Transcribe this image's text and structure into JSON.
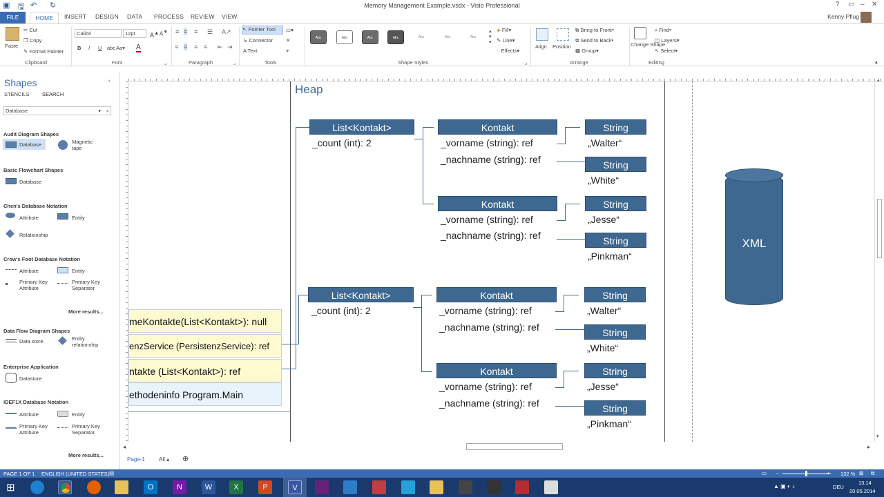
{
  "window": {
    "title": "Memory Management Example.vsdx - Visio Professional",
    "user": "Kenny Pflug"
  },
  "tabs": [
    "FILE",
    "HOME",
    "INSERT",
    "DESIGN",
    "DATA",
    "PROCESS",
    "REVIEW",
    "VIEW"
  ],
  "ribbon": {
    "clipboard": {
      "paste": "Paste",
      "cut": "Cut",
      "copy": "Copy",
      "format_painter": "Format Painter",
      "label": "Clipboard"
    },
    "font": {
      "family": "Calibri",
      "size": "12pt",
      "label": "Font"
    },
    "paragraph": {
      "label": "Paragraph"
    },
    "tools": {
      "pointer": "Pointer Tool",
      "connector": "Connector",
      "text": "Text",
      "label": "Tools"
    },
    "shape_styles": {
      "label": "Shape Styles",
      "sample": "Abc",
      "fill": "Fill",
      "line": "Line",
      "effects": "Effects"
    },
    "arrange": {
      "align": "Align",
      "position": "Position",
      "bring_front": "Bring to Front",
      "send_back": "Send to Back",
      "group": "Group",
      "label": "Arrange"
    },
    "editing": {
      "change_shape": "Change Shape",
      "find": "Find",
      "layers": "Layers",
      "select": "Select",
      "label": "Editing"
    }
  },
  "shapes_pane": {
    "title": "Shapes",
    "stencils": "STENCILS",
    "search": "SEARCH",
    "query": "Database",
    "sections": [
      {
        "title": "Audit Diagram Shapes",
        "items": [
          "Database",
          "Magnetic tape"
        ]
      },
      {
        "title": "Basic Flowchart Shapes",
        "items": [
          "Database"
        ]
      },
      {
        "title": "Chen's Database Notation",
        "items": [
          "Attribute",
          "Entity",
          "Relationship"
        ]
      },
      {
        "title": "Crow's Foot Database Notation",
        "items": [
          "Attribute",
          "Entity",
          "Primary Key Attribute",
          "Primary Key Separator"
        ]
      },
      {
        "title": "Data Flow Diagram Shapes",
        "items": [
          "Data store",
          "Entity relationship"
        ]
      },
      {
        "title": "Enterprise Application",
        "items": [
          "Datastore"
        ]
      },
      {
        "title": "IDEF1X Database Notation",
        "items": [
          "Attribute",
          "Entity",
          "Primary Key Attribute",
          "Primary Key Separator"
        ]
      }
    ],
    "more_results": "More results..."
  },
  "diagram": {
    "heap_label": "Heap",
    "list_header": "List<Kontakt>",
    "count": "_count (int): 2",
    "kontakt_header": "Kontakt",
    "vorname": "_vorname (string): ref",
    "nachname": "_nachname (string): ref",
    "string_header": "String",
    "values": [
      "„Walter“",
      "„White“",
      "„Jesse“",
      "„Pinkman“"
    ],
    "stack_items": [
      "meKontakte(List<Kontakt>): null",
      "enzService (PersistenzService): ref",
      "ntakte (List<Kontakt>): ref",
      "ethodeninfo Program.Main"
    ],
    "xml_label": "XML"
  },
  "page_tabs": {
    "page": "Page-1",
    "all": "All"
  },
  "status": {
    "page": "PAGE 1 OF 1",
    "language": "ENGLISH (UNITED STATES)",
    "zoom": "132 %"
  },
  "taskbar": {
    "lang": "DEU",
    "time": "13:14",
    "date": "20.05.2014"
  }
}
